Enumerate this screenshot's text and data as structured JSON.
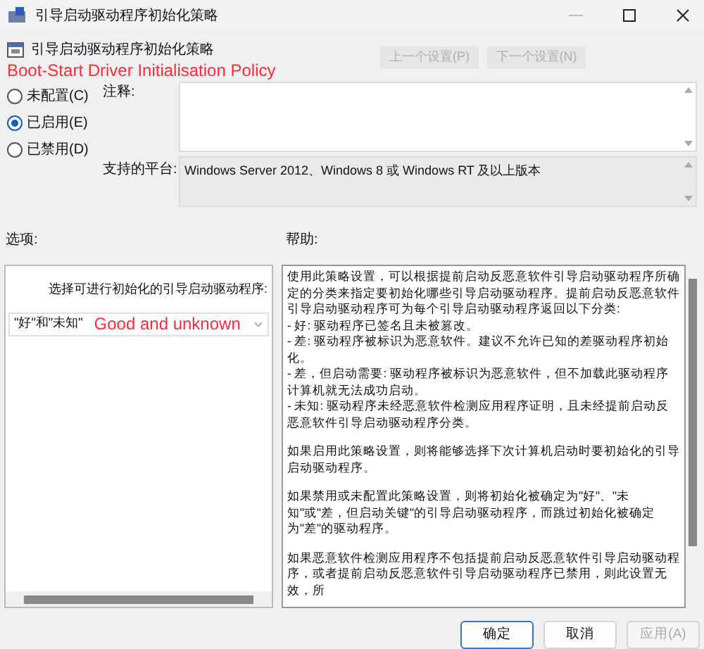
{
  "window": {
    "title": "引导启动驱动程序初始化策略"
  },
  "header": {
    "policy_name": "引导启动驱动程序初始化策略",
    "annotation": "Boot-Start Driver Initialisation Policy",
    "buttons": [
      {
        "label": "上一个设置(P)",
        "disabled": true
      },
      {
        "label": "下一个设置(N)",
        "disabled": true
      }
    ]
  },
  "state_options": [
    {
      "label": "未配置(C)",
      "selected": false
    },
    {
      "label": "已启用(E)",
      "selected": true
    },
    {
      "label": "已禁用(D)",
      "selected": false
    }
  ],
  "comment": {
    "label": "注释:"
  },
  "platform": {
    "label": "支持的平台:",
    "value": "Windows Server 2012、Windows 8 或 Windows RT 及以上版本"
  },
  "options": {
    "label": "选项:",
    "prompt": "选择可进行初始化的引导启动驱动程序:",
    "dropdown_value": "\"好\"和\"未知\"",
    "annotation": "Good and unknown"
  },
  "help": {
    "label": "帮助:",
    "paragraphs": [
      [
        "使用此策略设置，可以根据提前启动反恶意软件引导启动驱动程序所确定的分类来指定要初始化哪些引导启动驱动程序。提前启动反恶意软件引导启动驱动程序可为每个引导启动驱动程序返回以下分类:",
        "- 好: 驱动程序已签名且未被篡改。",
        "- 差: 驱动程序被标识为恶意软件。建议不允许已知的差驱动程序初始化。",
        "- 差，但启动需要: 驱动程序被标识为恶意软件，但不加载此驱动程序计算机就无法成功启动。",
        "- 未知: 驱动程序未经恶意软件检测应用程序证明，且未经提前启动反恶意软件引导启动驱动程序分类。"
      ],
      [
        "如果启用此策略设置，则将能够选择下次计算机启动时要初始化的引导启动驱动程序。"
      ],
      [
        "如果禁用或未配置此策略设置，则将初始化被确定为\"好\"、\"未知\"或\"差，但启动关键\"的引导启动驱动程序，而跳过初始化被确定为\"差\"的驱动程序。"
      ],
      [
        "如果恶意软件检测应用程序不包括提前启动反恶意软件引导启动驱动程序，或者提前启动反恶意软件引导启动驱动程序已禁用，则此设置无效，所"
      ]
    ]
  },
  "footer_buttons": [
    {
      "label": "确定",
      "kind": "default",
      "disabled": false
    },
    {
      "label": "取消",
      "kind": "normal",
      "disabled": false
    },
    {
      "label": "应用(A)",
      "kind": "normal",
      "disabled": true
    }
  ]
}
